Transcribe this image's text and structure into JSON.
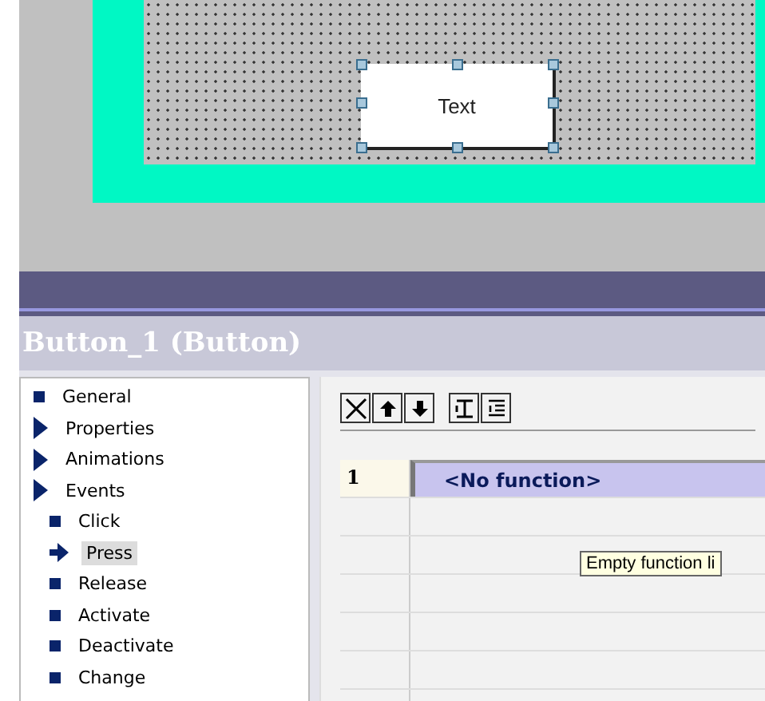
{
  "canvas": {
    "button_text": "Text"
  },
  "properties_title": "Button_1 (Button)",
  "tree": [
    {
      "label": "General",
      "kind": "leaf",
      "selected": false
    },
    {
      "label": "Properties",
      "kind": "group",
      "selected": false
    },
    {
      "label": "Animations",
      "kind": "group",
      "selected": false
    },
    {
      "label": "Events",
      "kind": "group",
      "selected": false,
      "children": [
        {
          "label": "Click",
          "kind": "leaf",
          "selected": false
        },
        {
          "label": "Press",
          "kind": "leaf",
          "selected": true
        },
        {
          "label": "Release",
          "kind": "leaf",
          "selected": false
        },
        {
          "label": "Activate",
          "kind": "leaf",
          "selected": false
        },
        {
          "label": "Deactivate",
          "kind": "leaf",
          "selected": false
        },
        {
          "label": "Change",
          "kind": "leaf",
          "selected": false
        }
      ]
    }
  ],
  "toolbar": [
    {
      "kind": "delete"
    },
    {
      "kind": "up"
    },
    {
      "kind": "down"
    },
    {
      "kind": "indent"
    },
    {
      "kind": "list"
    }
  ],
  "table": {
    "rows": [
      {
        "number": "1",
        "function": "<No function>",
        "selected": true
      }
    ]
  },
  "tooltip": "Empty function li"
}
